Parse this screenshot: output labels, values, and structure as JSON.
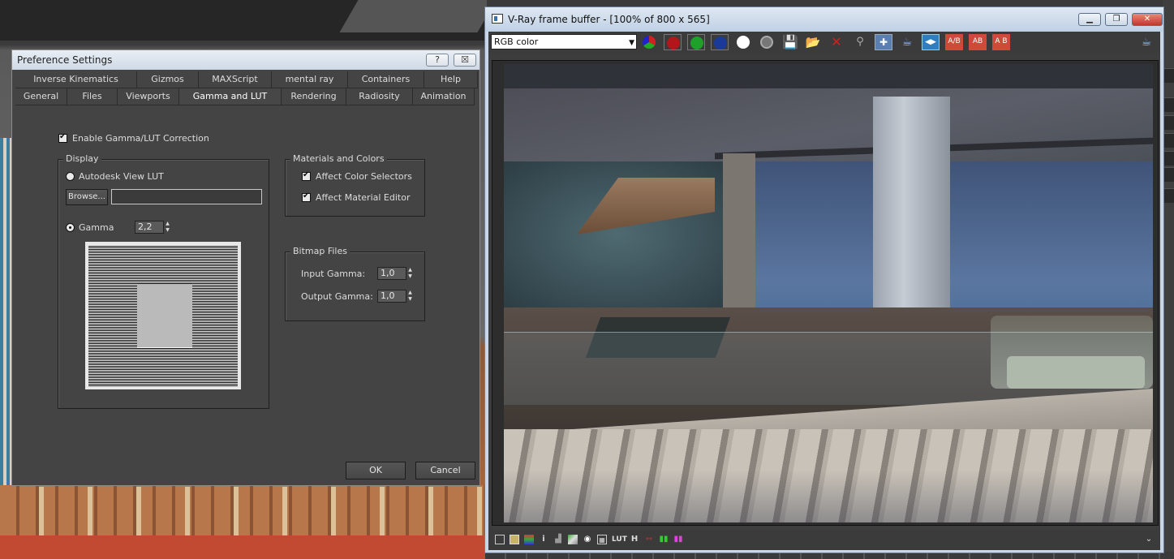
{
  "preferences": {
    "title": "Preference Settings",
    "help_btn": "?",
    "close_btn": "☒",
    "tabs_row1": [
      "Inverse Kinematics",
      "Gizmos",
      "MAXScript",
      "mental ray",
      "Containers",
      "Help"
    ],
    "tabs_row2": [
      "General",
      "Files",
      "Viewports",
      "Gamma and LUT",
      "Rendering",
      "Radiosity",
      "Animation"
    ],
    "active_tab": "Gamma and LUT",
    "enable_gamma_label": "Enable Gamma/LUT Correction",
    "display": {
      "title": "Display",
      "autodesk_lut_label": "Autodesk View LUT",
      "browse_label": "Browse...",
      "gamma_label": "Gamma",
      "gamma_value": "2,2"
    },
    "materials": {
      "title": "Materials and Colors",
      "affect_color_selectors": "Affect Color Selectors",
      "affect_material_editor": "Affect Material Editor"
    },
    "bitmap": {
      "title": "Bitmap Files",
      "input_gamma_label": "Input Gamma:",
      "input_gamma_value": "1,0",
      "output_gamma_label": "Output Gamma:",
      "output_gamma_value": "1,0"
    },
    "ok_label": "OK",
    "cancel_label": "Cancel"
  },
  "vfb": {
    "title": "V-Ray frame buffer - [100% of 800 x 565]",
    "channel_select": "RGB color",
    "colors": {
      "red_channel": "#b0161a",
      "green_channel": "#1ea02a",
      "blue_channel": "#1a3a9a",
      "close_accent": "#c0392b"
    },
    "bottom_icons": [
      "H",
      "LUT"
    ]
  }
}
